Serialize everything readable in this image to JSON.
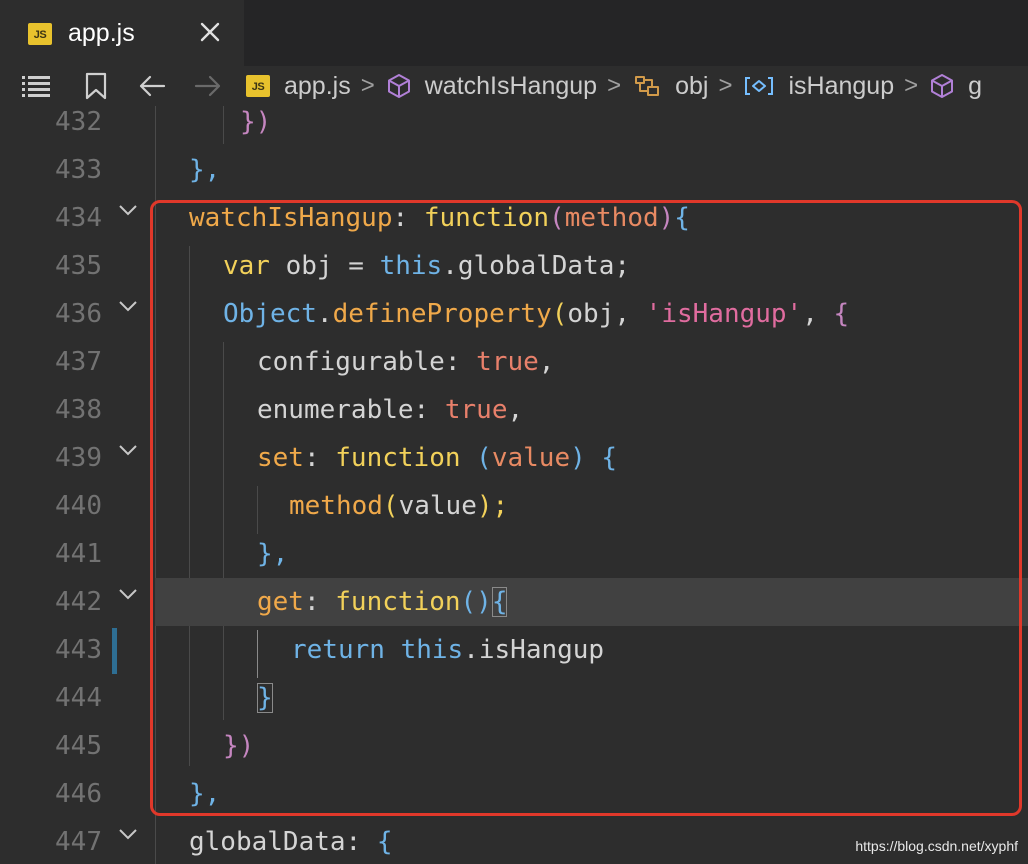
{
  "tab": {
    "icon": "js-file-icon",
    "badge": "JS",
    "title": "app.js",
    "close_icon": "close-icon"
  },
  "breadcrumb": {
    "toolbar_icons": [
      "list-icon",
      "bookmark-icon",
      "back-arrow-icon",
      "forward-arrow-icon"
    ],
    "items": [
      {
        "icon": "js-file-icon",
        "badge": "JS",
        "label": "app.js"
      },
      {
        "icon": "method-cube-icon",
        "label": "watchIsHangup"
      },
      {
        "icon": "field-icon",
        "label": "obj"
      },
      {
        "icon": "property-icon",
        "label": "isHangup"
      },
      {
        "icon": "method-cube-icon",
        "label": "g"
      }
    ],
    "separator": ">"
  },
  "editor": {
    "lines": [
      {
        "num": "432",
        "fold": false
      },
      {
        "num": "433",
        "fold": false
      },
      {
        "num": "434",
        "fold": true
      },
      {
        "num": "435",
        "fold": false
      },
      {
        "num": "436",
        "fold": true
      },
      {
        "num": "437",
        "fold": false
      },
      {
        "num": "438",
        "fold": false
      },
      {
        "num": "439",
        "fold": true
      },
      {
        "num": "440",
        "fold": false
      },
      {
        "num": "441",
        "fold": false
      },
      {
        "num": "442",
        "fold": true
      },
      {
        "num": "443",
        "fold": false
      },
      {
        "num": "444",
        "fold": false
      },
      {
        "num": "445",
        "fold": false
      },
      {
        "num": "446",
        "fold": false
      },
      {
        "num": "447",
        "fold": true
      }
    ],
    "tokens": {
      "l432": [
        "})"
      ],
      "l433": [
        "},"
      ],
      "l434": [
        "watchIsHangup",
        ": ",
        "function",
        "(",
        "method",
        ")",
        "{"
      ],
      "l435": [
        "var",
        " obj ",
        "=",
        " ",
        "this",
        ".globalData;"
      ],
      "l436": [
        "Object",
        ".",
        "defineProperty",
        "(",
        "obj, ",
        "'isHangup'",
        ", ",
        "{"
      ],
      "l437": [
        "configurable",
        ": ",
        "true",
        ","
      ],
      "l438": [
        "enumerable",
        ": ",
        "true",
        ","
      ],
      "l439": [
        "set",
        ": ",
        "function",
        " ",
        "(",
        "value",
        ")",
        " ",
        "{"
      ],
      "l440": [
        "method",
        "(",
        "value",
        ");"
      ],
      "l441": [
        "},"
      ],
      "l442": [
        "get",
        ": ",
        "function",
        "()",
        "{"
      ],
      "l443": [
        "return",
        " ",
        "this",
        ".isHangup"
      ],
      "l444": [
        "}"
      ],
      "l445": [
        "})"
      ],
      "l446": [
        "},"
      ],
      "l447": [
        "globalData",
        ": ",
        "{"
      ]
    },
    "current_line": "442",
    "highlight_color": "#e0382a"
  },
  "watermark": "https://blog.csdn.net/xyphf"
}
